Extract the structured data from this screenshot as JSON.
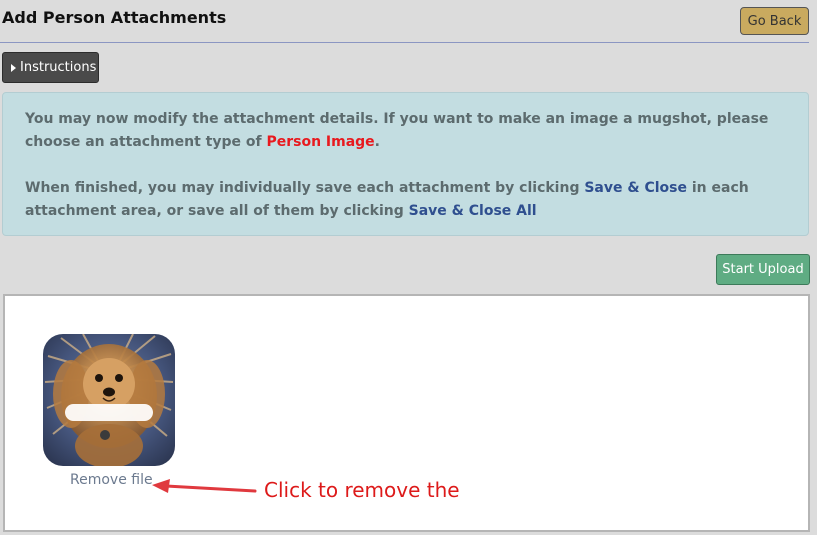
{
  "page": {
    "title": "Add Person Attachments",
    "go_back_label": "Go Back"
  },
  "instructions": {
    "button_label": "Instructions",
    "para1_text1": "You may now modify the attachment details. If you want to make an image a mugshot, please choose an attachment type of ",
    "para1_highlight": "Person Image",
    "para1_text2": ".",
    "para2_text1": "When finished, you may individually save each attachment by clicking ",
    "para2_link1": "Save & Close",
    "para2_text2": " in each attachment area, or save all of them by clicking ",
    "para2_link2": "Save & Close All"
  },
  "upload": {
    "start_upload_label": "Start Upload",
    "remove_file_label": "Remove file"
  },
  "annotation": {
    "text": "Click to remove the"
  },
  "colors": {
    "background": "#dcdcdc",
    "info_box": "#c3dde1",
    "go_back": "#c9aa5f",
    "start_upload": "#5fac83",
    "instructions_button": "#4a4a4a",
    "highlight_red": "#e8191e",
    "link_blue": "#2f4f8f",
    "annotation_red": "#dd1a1a"
  }
}
